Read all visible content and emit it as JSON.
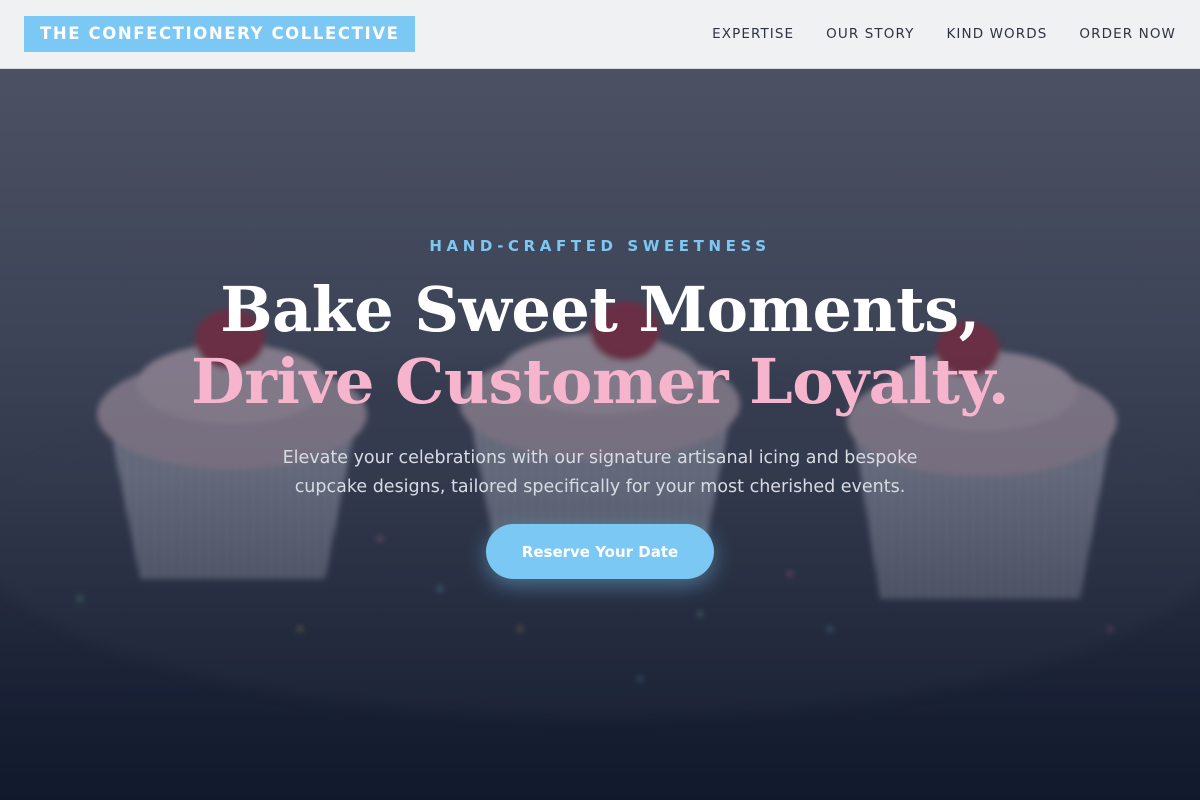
{
  "header": {
    "logo_text": "THE CONFECTIONERY COLLECTIVE",
    "nav": [
      {
        "label": "EXPERTISE"
      },
      {
        "label": "OUR STORY"
      },
      {
        "label": "KIND WORDS"
      },
      {
        "label": "ORDER NOW"
      }
    ]
  },
  "hero": {
    "eyebrow": "HAND-CRAFTED SWEETNESS",
    "headline_line1": "Bake Sweet Moments,",
    "headline_line2": "Drive Customer Loyalty.",
    "subcopy": "Elevate your celebrations with our signature artisanal icing and bespoke cupcake designs, tailored specifically for your most cherished events.",
    "cta_label": "Reserve Your Date",
    "background_image": "cupcakes-photo"
  },
  "colors": {
    "accent_blue": "#7cc8f4",
    "accent_pink": "#f6b4cd",
    "header_bg": "#f0f1f3",
    "hero_dark": "#1c2439"
  }
}
